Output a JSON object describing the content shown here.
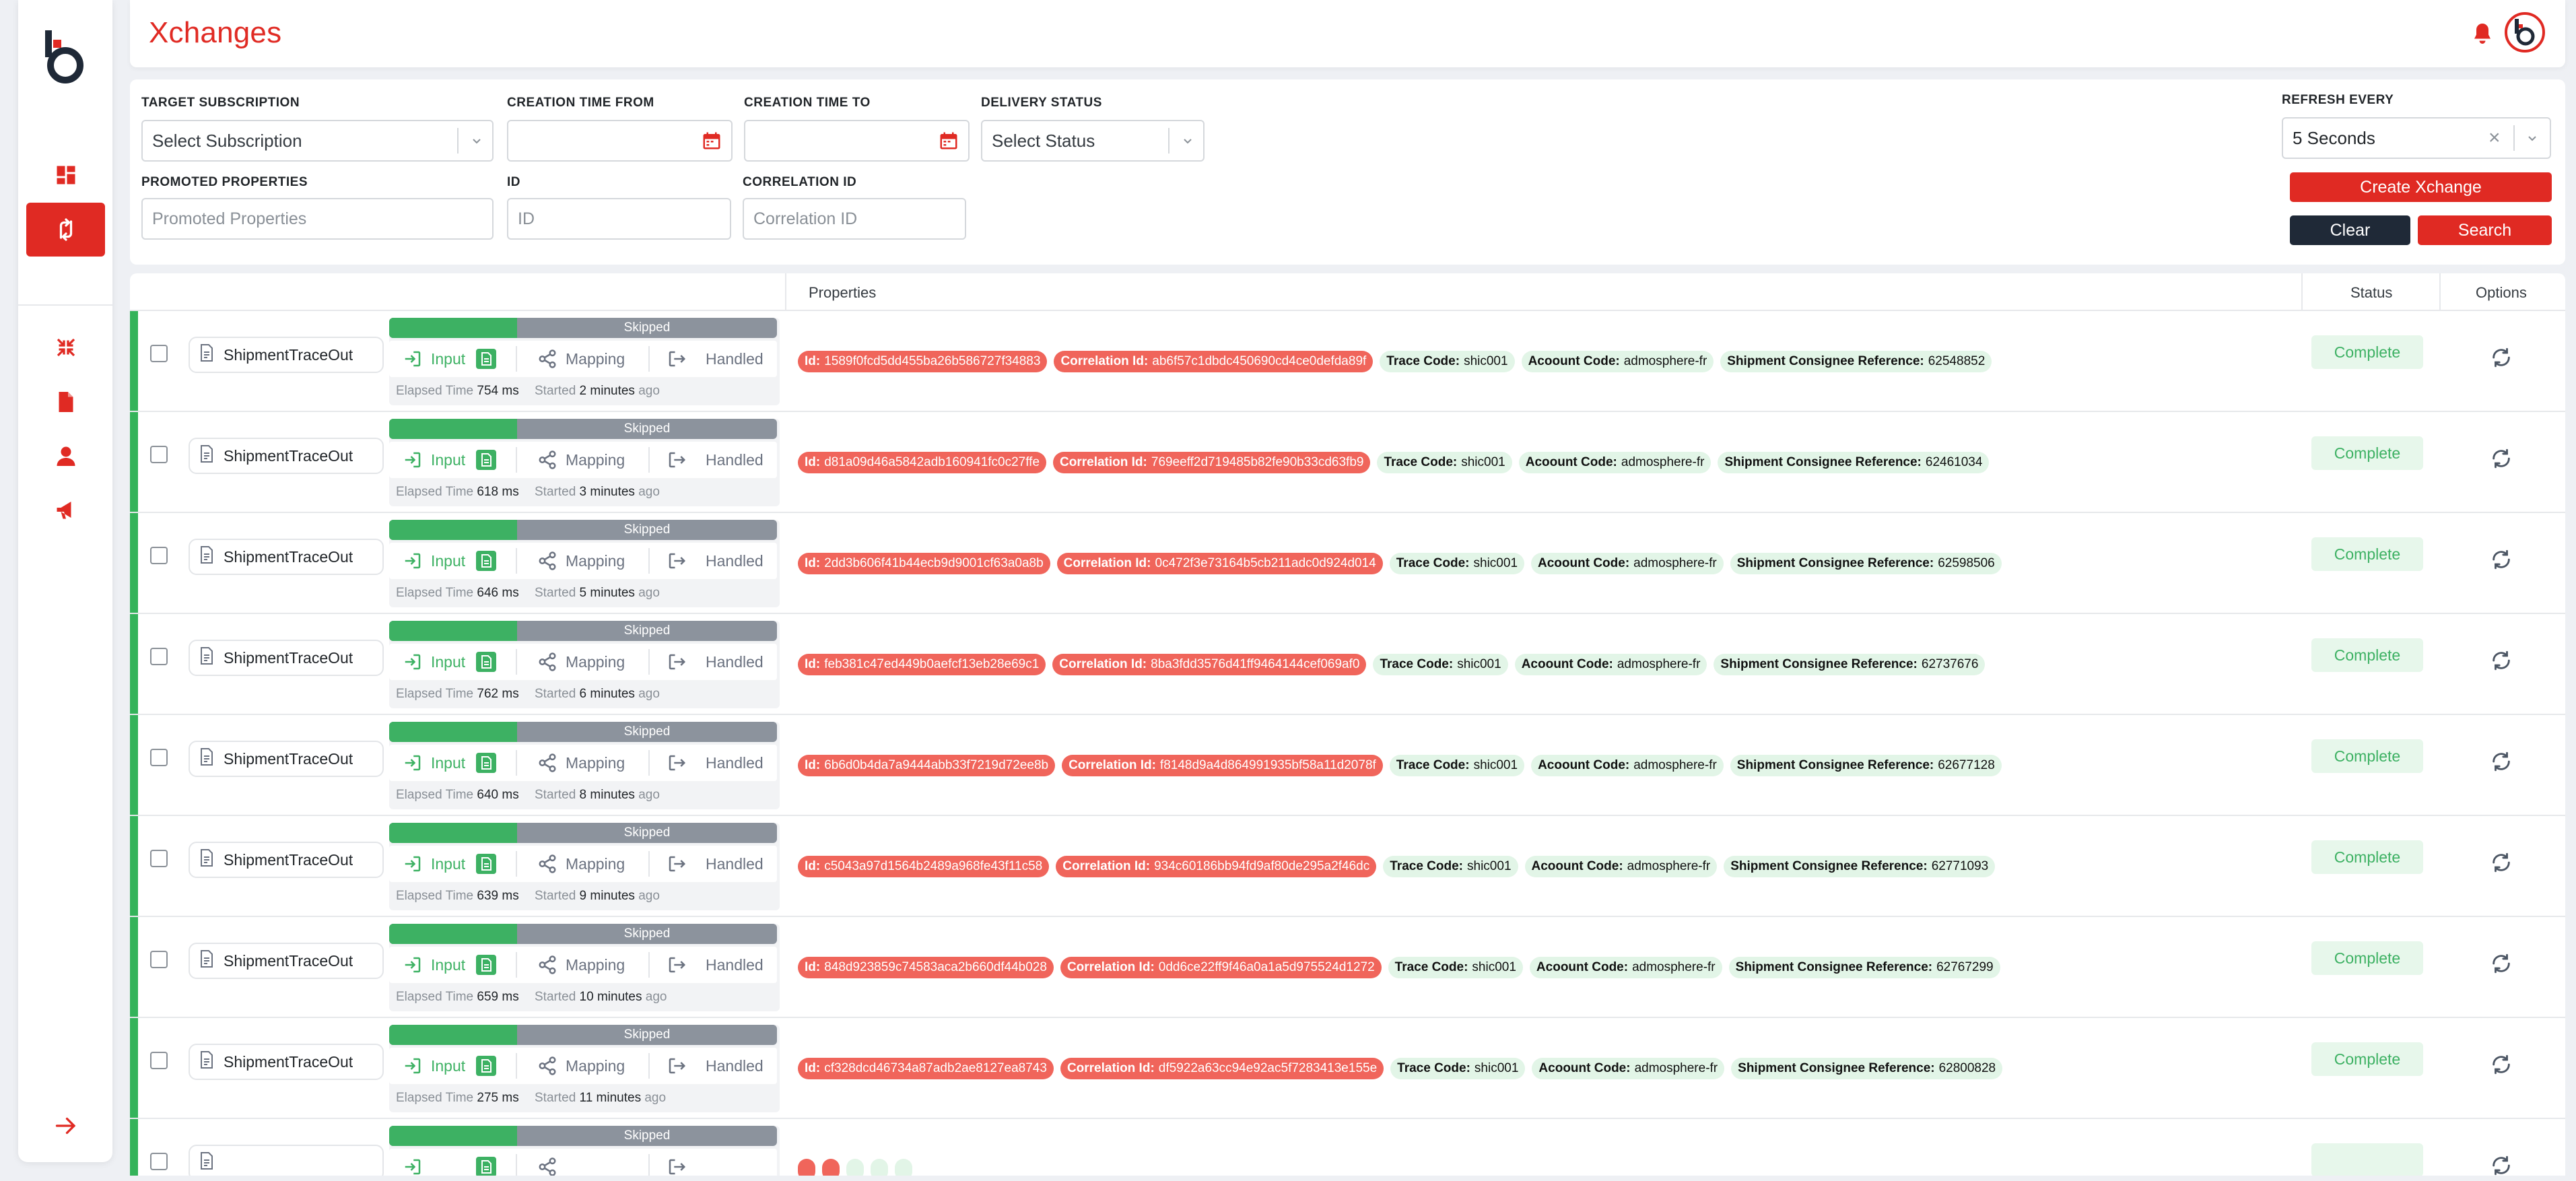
{
  "app": {
    "title": "Xchanges"
  },
  "sidebar": {
    "icons": [
      "dashboard-icon",
      "exchange-icon",
      "shrink-icon",
      "file-icon",
      "user-icon",
      "megaphone-icon",
      "arrow-right-icon"
    ]
  },
  "filters": {
    "target_subscription": {
      "label": "TARGET SUBSCRIPTION",
      "placeholder": "Select Subscription"
    },
    "creation_from": {
      "label": "CREATION TIME FROM",
      "value": ""
    },
    "creation_to": {
      "label": "CREATION TIME TO",
      "value": ""
    },
    "delivery_status": {
      "label": "DELIVERY STATUS",
      "placeholder": "Select Status"
    },
    "refresh_every": {
      "label": "REFRESH EVERY",
      "value": "5 Seconds"
    },
    "promoted_properties": {
      "label": "PROMOTED PROPERTIES",
      "placeholder": "Promoted Properties"
    },
    "id": {
      "label": "ID",
      "placeholder": "ID"
    },
    "correlation_id": {
      "label": "CORRELATION ID",
      "placeholder": "Correlation ID"
    },
    "buttons": {
      "create": "Create Xchange",
      "clear": "Clear",
      "search": "Search"
    }
  },
  "table": {
    "headers": {
      "properties": "Properties",
      "status": "Status",
      "options": "Options"
    },
    "rows": [
      {
        "type": "ShipmentTraceOut",
        "progress": "Skipped",
        "steps": {
          "input": "Input",
          "mapping": "Mapping",
          "handled": "Handled"
        },
        "elapsed_label": "Elapsed Time",
        "elapsed": "754 ms",
        "started_label": "Started",
        "started": "2 minutes",
        "ago": "ago",
        "id_label": "Id:",
        "id": "1589f0fcd5dd455ba26b586727f34883",
        "corr_label": "Correlation Id:",
        "corr": "ab6f57c1dbdc450690cd4ce0defda89f",
        "trace_label": "Trace Code:",
        "trace": "shic001",
        "account_label": "Acoount Code:",
        "account": "admosphere-fr",
        "ref_label": "Shipment Consignee Reference:",
        "ref": "62548852",
        "status": "Complete"
      },
      {
        "type": "ShipmentTraceOut",
        "progress": "Skipped",
        "steps": {
          "input": "Input",
          "mapping": "Mapping",
          "handled": "Handled"
        },
        "elapsed_label": "Elapsed Time",
        "elapsed": "618 ms",
        "started_label": "Started",
        "started": "3 minutes",
        "ago": "ago",
        "id_label": "Id:",
        "id": "d81a09d46a5842adb160941fc0c27ffe",
        "corr_label": "Correlation Id:",
        "corr": "769eeff2d719485b82fe90b33cd63fb9",
        "trace_label": "Trace Code:",
        "trace": "shic001",
        "account_label": "Acoount Code:",
        "account": "admosphere-fr",
        "ref_label": "Shipment Consignee Reference:",
        "ref": "62461034",
        "status": "Complete"
      },
      {
        "type": "ShipmentTraceOut",
        "progress": "Skipped",
        "steps": {
          "input": "Input",
          "mapping": "Mapping",
          "handled": "Handled"
        },
        "elapsed_label": "Elapsed Time",
        "elapsed": "646 ms",
        "started_label": "Started",
        "started": "5 minutes",
        "ago": "ago",
        "id_label": "Id:",
        "id": "2dd3b606f41b44ecb9d9001cf63a0a8b",
        "corr_label": "Correlation Id:",
        "corr": "0c472f3e73164b5cb211adc0d924d014",
        "trace_label": "Trace Code:",
        "trace": "shic001",
        "account_label": "Acoount Code:",
        "account": "admosphere-fr",
        "ref_label": "Shipment Consignee Reference:",
        "ref": "62598506",
        "status": "Complete"
      },
      {
        "type": "ShipmentTraceOut",
        "progress": "Skipped",
        "steps": {
          "input": "Input",
          "mapping": "Mapping",
          "handled": "Handled"
        },
        "elapsed_label": "Elapsed Time",
        "elapsed": "762 ms",
        "started_label": "Started",
        "started": "6 minutes",
        "ago": "ago",
        "id_label": "Id:",
        "id": "feb381c47ed449b0aefcf13eb28e69c1",
        "corr_label": "Correlation Id:",
        "corr": "8ba3fdd3576d41ff9464144cef069af0",
        "trace_label": "Trace Code:",
        "trace": "shic001",
        "account_label": "Acoount Code:",
        "account": "admosphere-fr",
        "ref_label": "Shipment Consignee Reference:",
        "ref": "62737676",
        "status": "Complete"
      },
      {
        "type": "ShipmentTraceOut",
        "progress": "Skipped",
        "steps": {
          "input": "Input",
          "mapping": "Mapping",
          "handled": "Handled"
        },
        "elapsed_label": "Elapsed Time",
        "elapsed": "640 ms",
        "started_label": "Started",
        "started": "8 minutes",
        "ago": "ago",
        "id_label": "Id:",
        "id": "6b6d0b4da7a9444abb33f7219d72ee8b",
        "corr_label": "Correlation Id:",
        "corr": "f8148d9a4d864991935bf58a11d2078f",
        "trace_label": "Trace Code:",
        "trace": "shic001",
        "account_label": "Acoount Code:",
        "account": "admosphere-fr",
        "ref_label": "Shipment Consignee Reference:",
        "ref": "62677128",
        "status": "Complete"
      },
      {
        "type": "ShipmentTraceOut",
        "progress": "Skipped",
        "steps": {
          "input": "Input",
          "mapping": "Mapping",
          "handled": "Handled"
        },
        "elapsed_label": "Elapsed Time",
        "elapsed": "639 ms",
        "started_label": "Started",
        "started": "9 minutes",
        "ago": "ago",
        "id_label": "Id:",
        "id": "c5043a97d1564b2489a968fe43f11c58",
        "corr_label": "Correlation Id:",
        "corr": "934c60186bb94fd9af80de295a2f46dc",
        "trace_label": "Trace Code:",
        "trace": "shic001",
        "account_label": "Acoount Code:",
        "account": "admosphere-fr",
        "ref_label": "Shipment Consignee Reference:",
        "ref": "62771093",
        "status": "Complete"
      },
      {
        "type": "ShipmentTraceOut",
        "progress": "Skipped",
        "steps": {
          "input": "Input",
          "mapping": "Mapping",
          "handled": "Handled"
        },
        "elapsed_label": "Elapsed Time",
        "elapsed": "659 ms",
        "started_label": "Started",
        "started": "10 minutes",
        "ago": "ago",
        "id_label": "Id:",
        "id": "848d923859c74583aca2b660df44b028",
        "corr_label": "Correlation Id:",
        "corr": "0dd6ce22ff9f46a0a1a5d975524d1272",
        "trace_label": "Trace Code:",
        "trace": "shic001",
        "account_label": "Acoount Code:",
        "account": "admosphere-fr",
        "ref_label": "Shipment Consignee Reference:",
        "ref": "62767299",
        "status": "Complete"
      },
      {
        "type": "ShipmentTraceOut",
        "progress": "Skipped",
        "steps": {
          "input": "Input",
          "mapping": "Mapping",
          "handled": "Handled"
        },
        "elapsed_label": "Elapsed Time",
        "elapsed": "275 ms",
        "started_label": "Started",
        "started": "11 minutes",
        "ago": "ago",
        "id_label": "Id:",
        "id": "cf328dcd46734a87adb2ae8127ea8743",
        "corr_label": "Correlation Id:",
        "corr": "df5922a63cc94e92ac5f7283413e155e",
        "trace_label": "Trace Code:",
        "trace": "shic001",
        "account_label": "Acoount Code:",
        "account": "admosphere-fr",
        "ref_label": "Shipment Consignee Reference:",
        "ref": "62800828",
        "status": "Complete"
      },
      {
        "type": "",
        "progress": "Skipped",
        "steps": {
          "input": "",
          "mapping": "",
          "handled": ""
        },
        "elapsed_label": "",
        "elapsed": "",
        "started_label": "",
        "started": "",
        "ago": "",
        "id_label": "",
        "id": "",
        "corr_label": "",
        "corr": "",
        "trace_label": "",
        "trace": "",
        "account_label": "",
        "account": "",
        "ref_label": "",
        "ref": "",
        "status": ""
      }
    ]
  },
  "colors": {
    "brand_red": "#e02a23",
    "success_green": "#3db163",
    "pill_red": "#f0655b",
    "pill_green": "#e2f5e7"
  }
}
